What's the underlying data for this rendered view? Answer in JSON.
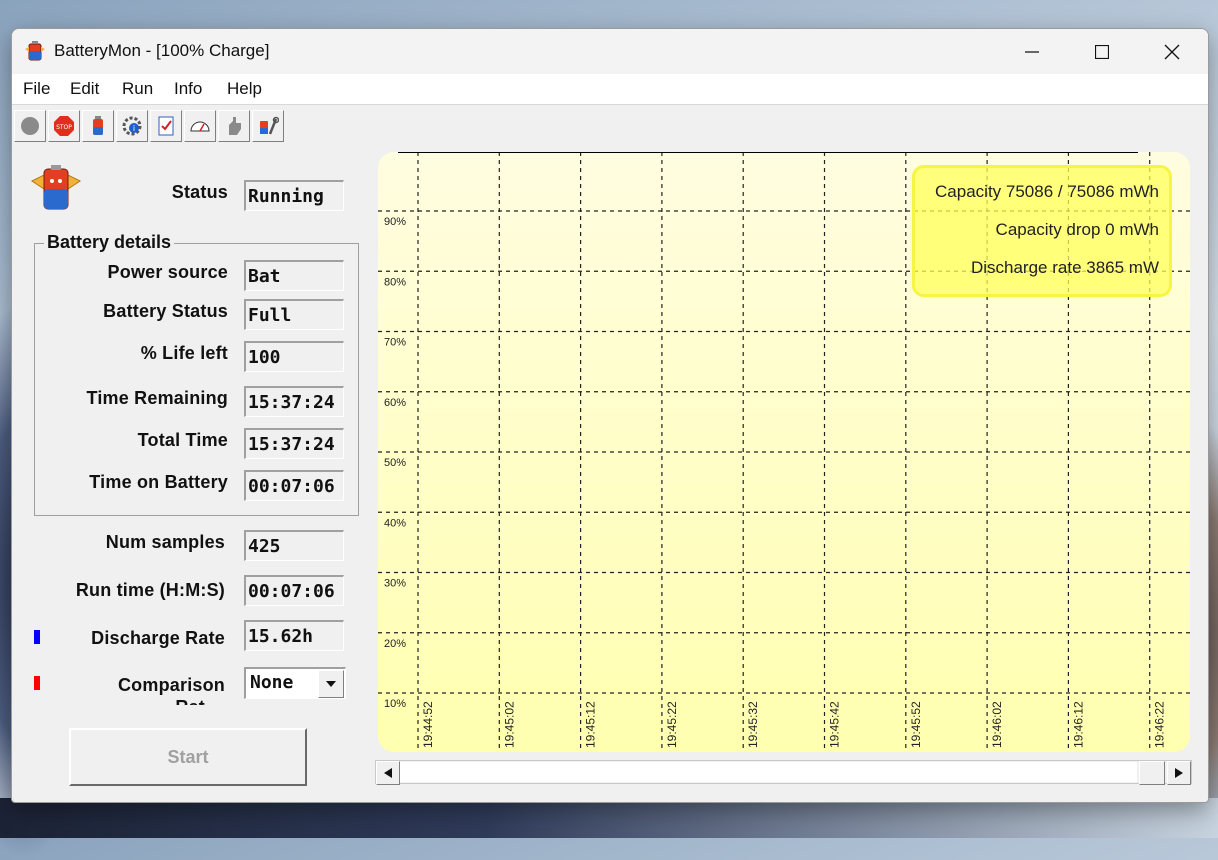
{
  "window": {
    "title": "BatteryMon - [100% Charge]"
  },
  "menu": [
    "File",
    "Edit",
    "Run",
    "Info",
    "Help"
  ],
  "toolbar": {
    "icons": [
      "stop-circle-icon",
      "stop-sign-icon",
      "battery-icon",
      "gear-info-icon",
      "checklist-icon",
      "gauge-icon",
      "hand-icon",
      "tools-icon"
    ]
  },
  "status": {
    "label": "Status",
    "value": "Running"
  },
  "details": {
    "group_title": "Battery details",
    "rows": [
      {
        "label": "Power source",
        "value": "Bat"
      },
      {
        "label": "Battery Status",
        "value": "Full"
      },
      {
        "label": "% Life left",
        "value": "100"
      },
      {
        "label": "Time Remaining",
        "value": "15:37:24"
      },
      {
        "label": "Total Time",
        "value": "15:37:24"
      },
      {
        "label": "Time on Battery",
        "value": "00:07:06"
      }
    ]
  },
  "stats": {
    "num_samples": {
      "label": "Num samples",
      "value": "425"
    },
    "run_time": {
      "label": "Run time (H:M:S)",
      "value": "00:07:06"
    },
    "discharge_rate": {
      "label": "Discharge Rate",
      "value": "15.62h",
      "marker_color": "#0000ff"
    },
    "comparison": {
      "label": "Comparison",
      "label_overflow": "Rat",
      "value": "None",
      "marker_color": "#ff0000"
    }
  },
  "start_button": {
    "label": "Start"
  },
  "chart_data": {
    "type": "line",
    "title": "",
    "xlabel": "",
    "ylabel": "",
    "y_tick_labels": [
      "90%",
      "80%",
      "70%",
      "60%",
      "50%",
      "40%",
      "30%",
      "20%",
      "10%"
    ],
    "x_tick_labels": [
      "19:44:52",
      "19:45:02",
      "19:45:12",
      "19:45:22",
      "19:45:32",
      "19:45:42",
      "19:45:52",
      "19:46:02",
      "19:46:12",
      "19:46:22"
    ],
    "ylim": [
      0,
      100
    ],
    "grid": true,
    "background": "#ffffb0",
    "series": [
      {
        "color": "#000000",
        "x": [
          "19:44:52",
          "19:46:22"
        ],
        "values": [
          100,
          100
        ]
      }
    ],
    "legend_box": {
      "lines": [
        "Capacity 75086 / 75086 mWh",
        "Capacity drop 0 mWh",
        "Discharge rate 3865 mW"
      ],
      "placement": "top-right"
    }
  }
}
